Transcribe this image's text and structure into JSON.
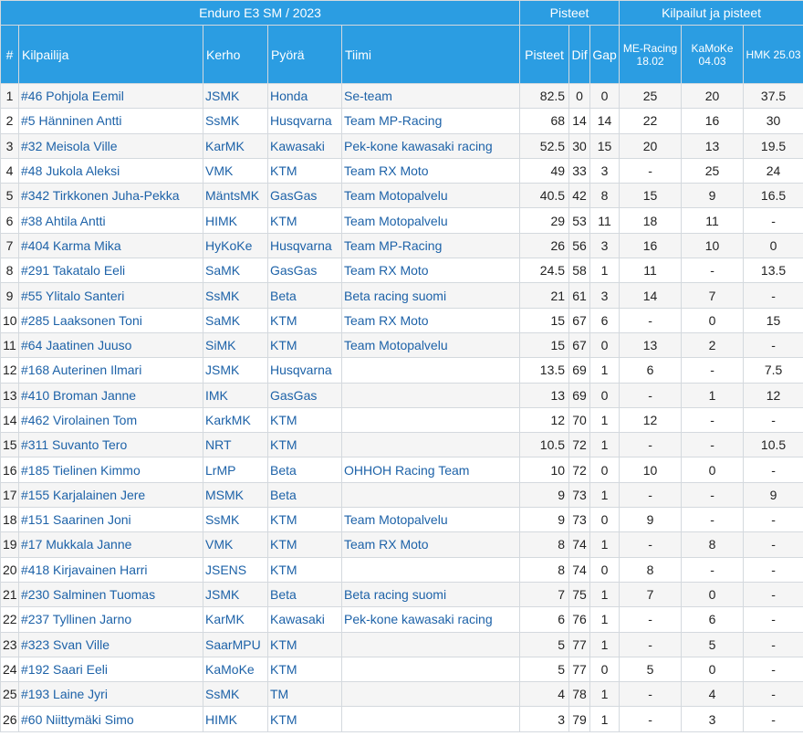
{
  "header": {
    "series_title": "Enduro E3 SM / 2023",
    "points_group": "Pisteet",
    "races_group": "Kilpailut ja pisteet"
  },
  "columns": {
    "pos": "#",
    "rider": "Kilpailija",
    "club": "Kerho",
    "bike": "Pyörä",
    "team": "Tiimi",
    "points": "Pisteet",
    "dif": "Dif",
    "gap": "Gap",
    "race1": "ME-Racing 18.02",
    "race2": "KaMoKe 04.03",
    "race3": "HMK 25.03"
  },
  "rows": [
    {
      "pos": "1",
      "rider": "#46 Pohjola Eemil",
      "club": "JSMK",
      "bike": "Honda",
      "team": "Se-team",
      "points": "82.5",
      "dif": "0",
      "gap": "0",
      "r1": "25",
      "r2": "20",
      "r3": "37.5"
    },
    {
      "pos": "2",
      "rider": "#5 Hänninen Antti",
      "club": "SsMK",
      "bike": "Husqvarna",
      "team": "Team MP-Racing",
      "points": "68",
      "dif": "14",
      "gap": "14",
      "r1": "22",
      "r2": "16",
      "r3": "30"
    },
    {
      "pos": "3",
      "rider": "#32 Meisola Ville",
      "club": "KarMK",
      "bike": "Kawasaki",
      "team": " Pek-kone kawasaki racing",
      "points": "52.5",
      "dif": "30",
      "gap": "15",
      "r1": "20",
      "r2": "13",
      "r3": "19.5"
    },
    {
      "pos": "4",
      "rider": "#48 Jukola Aleksi",
      "club": "VMK",
      "bike": "KTM",
      "team": "Team RX Moto",
      "points": "49",
      "dif": "33",
      "gap": "3",
      "r1": "-",
      "r2": "25",
      "r3": "24"
    },
    {
      "pos": "5",
      "rider": "#342 Tirkkonen Juha-Pekka",
      "club": "MäntsMK",
      "bike": "GasGas",
      "team": "Team Motopalvelu",
      "points": "40.5",
      "dif": "42",
      "gap": "8",
      "r1": "15",
      "r2": "9",
      "r3": "16.5"
    },
    {
      "pos": "6",
      "rider": "#38 Ahtila Antti",
      "club": "HIMK",
      "bike": "KTM",
      "team": "Team Motopalvelu",
      "points": "29",
      "dif": "53",
      "gap": "11",
      "r1": "18",
      "r2": "11",
      "r3": "-"
    },
    {
      "pos": "7",
      "rider": "#404 Karma Mika",
      "club": "HyKoKe",
      "bike": "Husqvarna",
      "team": "Team MP-Racing",
      "points": "26",
      "dif": "56",
      "gap": "3",
      "r1": "16",
      "r2": "10",
      "r3": "0"
    },
    {
      "pos": "8",
      "rider": "#291 Takatalo Eeli",
      "club": "SaMK",
      "bike": "GasGas",
      "team": "Team RX Moto",
      "points": "24.5",
      "dif": "58",
      "gap": "1",
      "r1": "11",
      "r2": "-",
      "r3": "13.5"
    },
    {
      "pos": "9",
      "rider": "#55 Ylitalo Santeri",
      "club": "SsMK",
      "bike": "Beta",
      "team": "Beta racing suomi",
      "points": "21",
      "dif": "61",
      "gap": "3",
      "r1": "14",
      "r2": "7",
      "r3": "-"
    },
    {
      "pos": "10",
      "rider": "#285 Laaksonen Toni",
      "club": "SaMK",
      "bike": "KTM",
      "team": "Team RX Moto",
      "points": "15",
      "dif": "67",
      "gap": "6",
      "r1": "-",
      "r2": "0",
      "r3": "15"
    },
    {
      "pos": "11",
      "rider": "#64 Jaatinen Juuso",
      "club": "SiMK",
      "bike": "KTM",
      "team": "Team Motopalvelu",
      "points": "15",
      "dif": "67",
      "gap": "0",
      "r1": "13",
      "r2": "2",
      "r3": "-"
    },
    {
      "pos": "12",
      "rider": "#168 Auterinen Ilmari",
      "club": "JSMK",
      "bike": "Husqvarna",
      "team": "",
      "points": "13.5",
      "dif": "69",
      "gap": "1",
      "r1": "6",
      "r2": "-",
      "r3": "7.5"
    },
    {
      "pos": "13",
      "rider": "#410 Broman Janne",
      "club": "IMK",
      "bike": "GasGas",
      "team": "",
      "points": "13",
      "dif": "69",
      "gap": "0",
      "r1": "-",
      "r2": "1",
      "r3": "12"
    },
    {
      "pos": "14",
      "rider": "#462 Virolainen Tom",
      "club": "KarkMK",
      "bike": "KTM",
      "team": "",
      "points": "12",
      "dif": "70",
      "gap": "1",
      "r1": "12",
      "r2": "-",
      "r3": "-"
    },
    {
      "pos": "15",
      "rider": "#311 Suvanto Tero",
      "club": "NRT",
      "bike": "KTM",
      "team": "",
      "points": "10.5",
      "dif": "72",
      "gap": "1",
      "r1": "-",
      "r2": "-",
      "r3": "10.5"
    },
    {
      "pos": "16",
      "rider": "#185 Tielinen Kimmo",
      "club": "LrMP",
      "bike": "Beta",
      "team": "OHHOH Racing Team",
      "points": "10",
      "dif": "72",
      "gap": "0",
      "r1": "10",
      "r2": "0",
      "r3": "-"
    },
    {
      "pos": "17",
      "rider": "#155 Karjalainen Jere",
      "club": "MSMK",
      "bike": "Beta",
      "team": "",
      "points": "9",
      "dif": "73",
      "gap": "1",
      "r1": "-",
      "r2": "-",
      "r3": "9"
    },
    {
      "pos": "18",
      "rider": "#151 Saarinen Joni",
      "club": "SsMK",
      "bike": "KTM",
      "team": "Team Motopalvelu",
      "points": "9",
      "dif": "73",
      "gap": "0",
      "r1": "9",
      "r2": "-",
      "r3": "-"
    },
    {
      "pos": "19",
      "rider": "#17 Mukkala Janne",
      "club": "VMK",
      "bike": "KTM",
      "team": "Team RX Moto",
      "points": "8",
      "dif": "74",
      "gap": "1",
      "r1": "-",
      "r2": "8",
      "r3": "-"
    },
    {
      "pos": "20",
      "rider": "#418 Kirjavainen Harri",
      "club": "JSENS",
      "bike": "KTM",
      "team": "",
      "points": "8",
      "dif": "74",
      "gap": "0",
      "r1": "8",
      "r2": "-",
      "r3": "-"
    },
    {
      "pos": "21",
      "rider": "#230 Salminen Tuomas",
      "club": "JSMK",
      "bike": "Beta",
      "team": "Beta racing suomi",
      "points": "7",
      "dif": "75",
      "gap": "1",
      "r1": "7",
      "r2": "0",
      "r3": "-"
    },
    {
      "pos": "22",
      "rider": "#237 Tyllinen Jarno",
      "club": "KarMK",
      "bike": "Kawasaki",
      "team": "Pek-kone kawasaki racing",
      "points": "6",
      "dif": "76",
      "gap": "1",
      "r1": "-",
      "r2": "6",
      "r3": "-"
    },
    {
      "pos": "23",
      "rider": "#323 Svan Ville",
      "club": "SaarMPU",
      "bike": "KTM",
      "team": "",
      "points": "5",
      "dif": "77",
      "gap": "1",
      "r1": "-",
      "r2": "5",
      "r3": "-"
    },
    {
      "pos": "24",
      "rider": "#192 Saari Eeli",
      "club": "KaMoKe",
      "bike": "KTM",
      "team": "",
      "points": "5",
      "dif": "77",
      "gap": "0",
      "r1": "5",
      "r2": "0",
      "r3": "-"
    },
    {
      "pos": "25",
      "rider": "#193 Laine Jyri",
      "club": "SsMK",
      "bike": "TM",
      "team": "",
      "points": "4",
      "dif": "78",
      "gap": "1",
      "r1": "-",
      "r2": "4",
      "r3": "-"
    },
    {
      "pos": "26",
      "rider": "#60 Niittymäki Simo",
      "club": "HIMK",
      "bike": "KTM",
      "team": "",
      "points": "3",
      "dif": "79",
      "gap": "1",
      "r1": "-",
      "r2": "3",
      "r3": "-"
    }
  ]
}
